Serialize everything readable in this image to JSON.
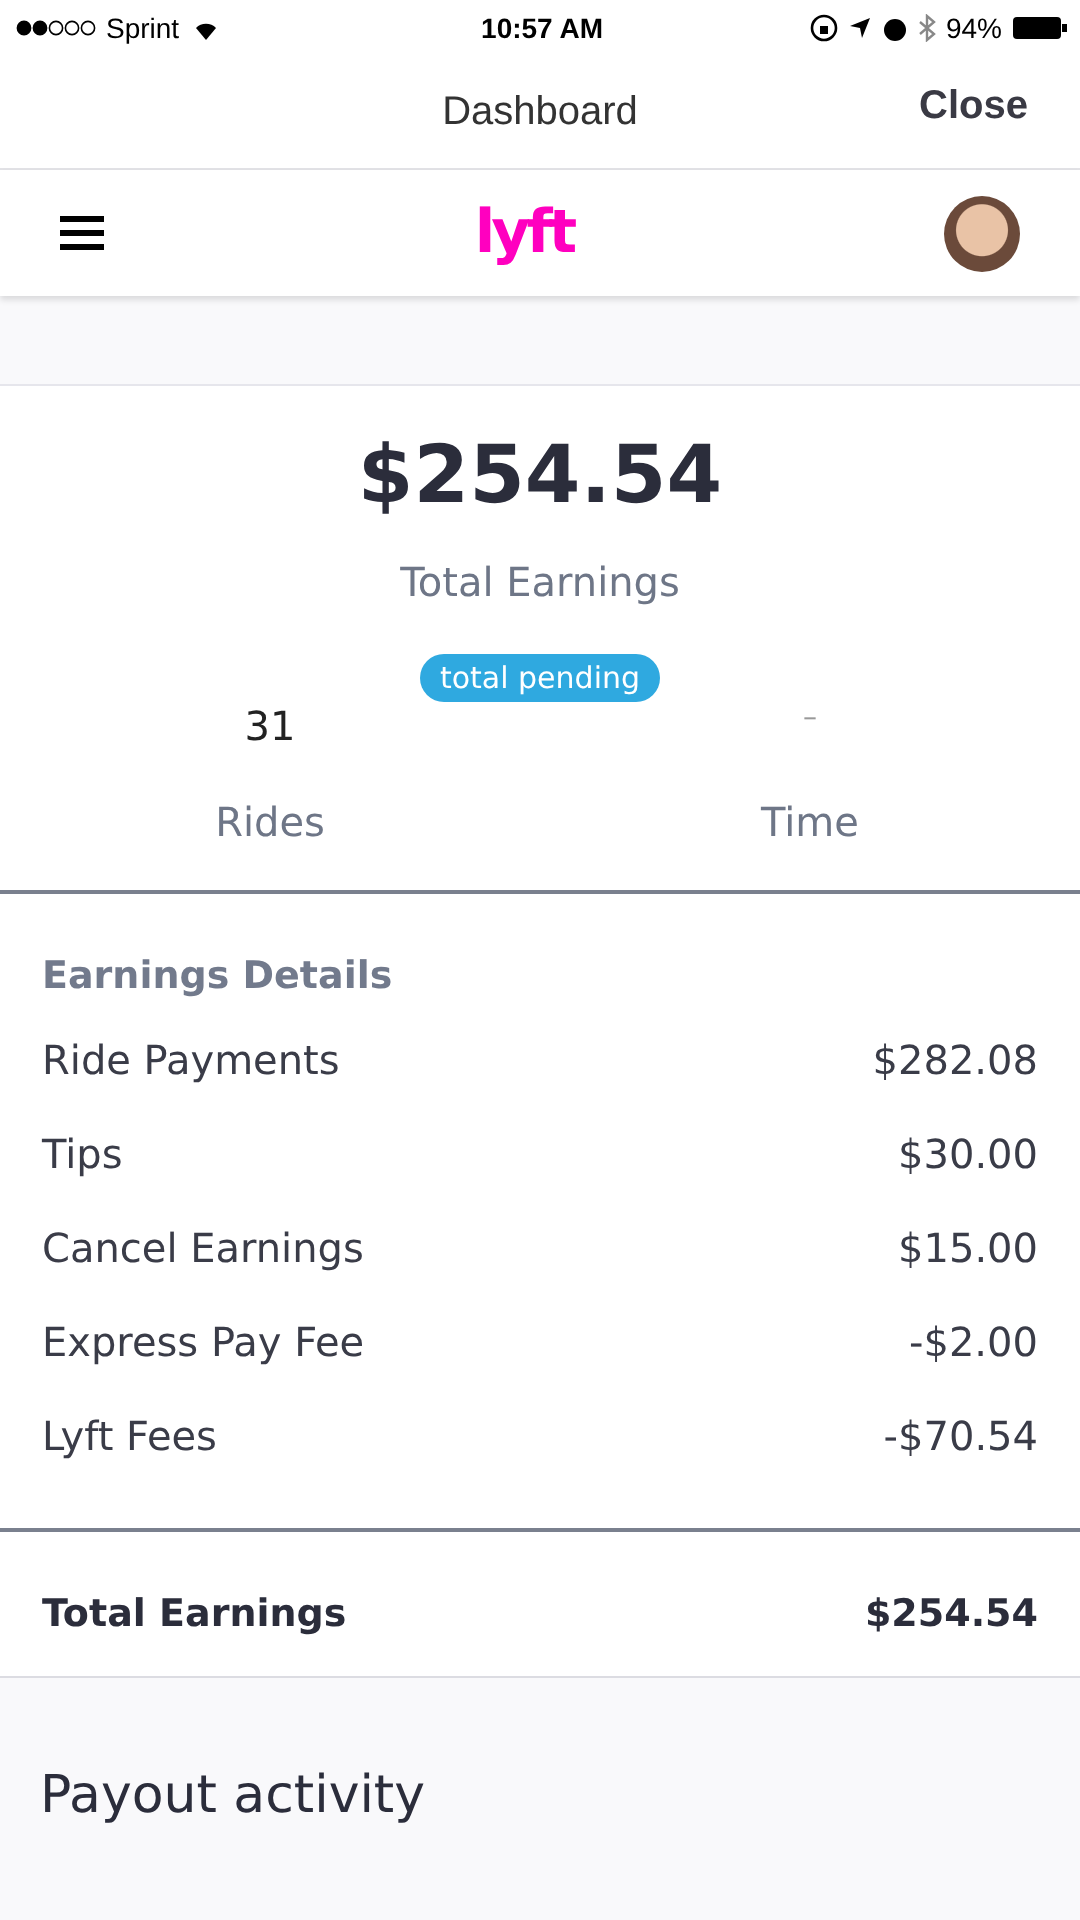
{
  "status_bar": {
    "carrier": "Sprint",
    "time": "10:57 AM",
    "battery": "94%"
  },
  "nav": {
    "title": "Dashboard",
    "close": "Close"
  },
  "app_bar": {
    "logo": "lyft"
  },
  "summary": {
    "amount": "$254.54",
    "label": "Total Earnings",
    "badge": "total pending",
    "stats": [
      {
        "value": "31",
        "label": "Rides"
      },
      {
        "value": "–",
        "label": "Time"
      }
    ]
  },
  "details": {
    "title": "Earnings Details",
    "rows": [
      {
        "label": "Ride Payments",
        "value": "$282.08"
      },
      {
        "label": "Tips",
        "value": "$30.00"
      },
      {
        "label": "Cancel Earnings",
        "value": "$15.00"
      },
      {
        "label": "Express Pay Fee",
        "value": "-$2.00"
      },
      {
        "label": "Lyft Fees",
        "value": "-$70.54"
      }
    ],
    "total": {
      "label": "Total Earnings",
      "value": "$254.54"
    }
  },
  "payout": {
    "title": "Payout activity"
  }
}
